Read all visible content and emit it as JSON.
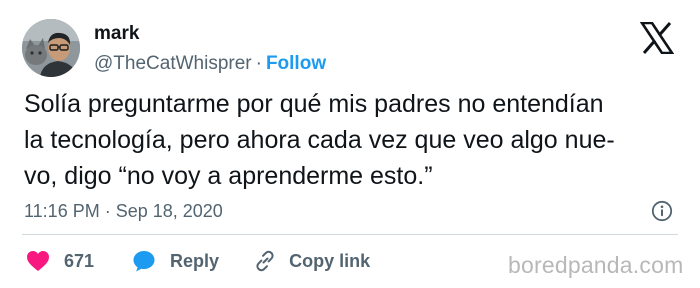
{
  "user": {
    "display_name": "mark",
    "handle": "@TheCatWhisprer",
    "separator": "·",
    "follow_label": "Follow"
  },
  "tweet": {
    "text_lines": [
      "Solía preguntarme por qué mis padres no entendían",
      "la tecnología, pero ahora cada vez que veo algo nue-",
      "vo, digo “no voy a aprenderme esto.”"
    ],
    "time": "11:16 PM",
    "separator": "·",
    "date": "Sep 18, 2020"
  },
  "actions": {
    "likes": "671",
    "reply_label": "Reply",
    "copy_label": "Copy link"
  },
  "watermark": "boredpanda.com",
  "icons": {
    "brand": "x-logo-icon",
    "info": "info-icon",
    "like": "heart-icon",
    "reply": "speech-bubble-icon",
    "copy": "link-icon"
  },
  "colors": {
    "text": "#0f1419",
    "secondary": "#536471",
    "accent": "#1d9bf0",
    "like": "#f91880",
    "divider": "#cfd9de",
    "watermark": "#b8b8b8"
  }
}
